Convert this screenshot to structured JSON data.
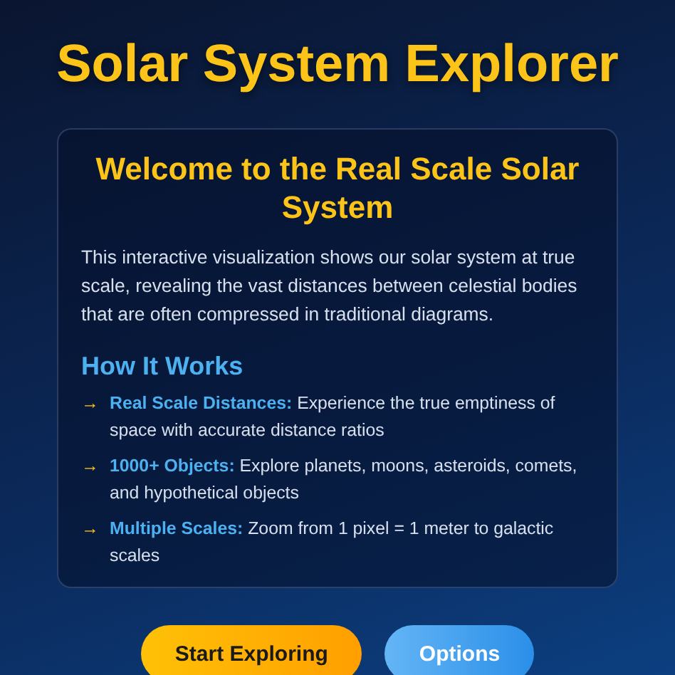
{
  "title": "Solar System Explorer",
  "card": {
    "heading": "Welcome to the Real Scale Solar System",
    "intro": "This interactive visualization shows our solar system at true scale, revealing the vast distances between celestial bodies that are often compressed in traditional diagrams.",
    "section_heading": "How It Works",
    "features": [
      {
        "bullet": "→",
        "label": "Real Scale Distances:",
        "text": "Experience the true emptiness of space with accurate distance ratios"
      },
      {
        "bullet": "→",
        "label": "1000+ Objects:",
        "text": "Explore planets, moons, asteroids, comets, and hypothetical objects"
      },
      {
        "bullet": "→",
        "label": "Multiple Scales:",
        "text": "Zoom from 1 pixel = 1 meter to galactic scales"
      }
    ]
  },
  "buttons": [
    {
      "label": "Start Exploring",
      "kind": "primary"
    },
    {
      "label": "Options",
      "kind": "secondary"
    }
  ]
}
